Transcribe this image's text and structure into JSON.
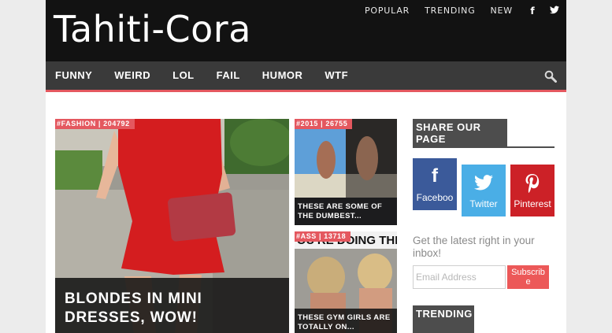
{
  "site": {
    "logo": "Tahiti-Cora"
  },
  "topnav": {
    "links": [
      "POPULAR",
      "TRENDING",
      "NEW"
    ],
    "facebook_icon": "f",
    "twitter_icon": "twitter-bird"
  },
  "mainnav": {
    "items": [
      "FUNNY",
      "WEIRD",
      "LOL",
      "FAIL",
      "HUMOR",
      "WTF"
    ],
    "search_icon": "magnifier"
  },
  "cards": [
    {
      "tag": "#FASHION | 204792",
      "title": "BLONDES IN MINI DRESSES, WOW!"
    },
    {
      "tag": "#2015 | 26755",
      "title": "THESE ARE SOME OF THE DUMBEST..."
    },
    {
      "tag": "#ASS | 13718",
      "title": "THESE GYM GIRLS ARE TOTALLY ON...",
      "image_text": "YOU'RE DOING THE"
    }
  ],
  "sidebar": {
    "share_title": "SHARE OUR PAGE",
    "social": [
      {
        "icon": "f",
        "label": "Faceboo"
      },
      {
        "icon": "twitter-bird",
        "label": "Twitter"
      },
      {
        "icon": "pinterest-p",
        "label": "Pinterest"
      }
    ],
    "newsletter_text": "Get the latest right in your inbox!",
    "email_placeholder": "Email Address",
    "subscribe_label": "Subscribe",
    "trending_title": "TRENDING"
  },
  "colors": {
    "accent": "#e4585f",
    "header_bg": "#121212",
    "nav_bg": "#3a3a3a",
    "facebook": "#3b5a9a",
    "twitter": "#4aaee6",
    "pinterest": "#cc2127"
  }
}
